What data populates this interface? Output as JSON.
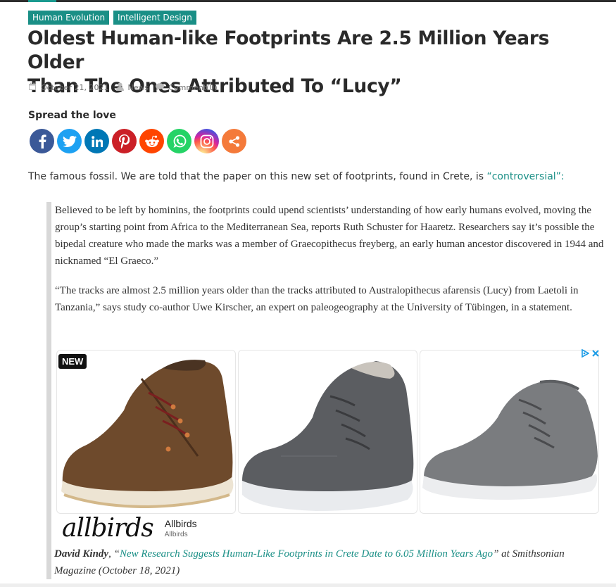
{
  "tags": [
    "Human Evolution",
    "Intelligent Design"
  ],
  "title_line1": "Oldest Human-like Footprints Are 2.5 Million Years Older",
  "title_line2": "Than The Ones Attributed To “Lucy”",
  "meta": {
    "date": "October 21, 2021",
    "category": "News",
    "comments": "Comment(0)"
  },
  "spread_label": "Spread the love",
  "socials": [
    {
      "name": "facebook",
      "color": "#3b5998"
    },
    {
      "name": "twitter",
      "color": "#1da1f2"
    },
    {
      "name": "linkedin",
      "color": "#0077b5"
    },
    {
      "name": "pinterest",
      "color": "#cb2027"
    },
    {
      "name": "reddit",
      "color": "#ff4500"
    },
    {
      "name": "whatsapp",
      "color": "#25d366"
    },
    {
      "name": "instagram",
      "color": "#c13584"
    },
    {
      "name": "more",
      "color": "#f47a3a"
    }
  ],
  "intro": {
    "text": "The famous fossil. We are told that the paper on this new set of footprints, found in Crete, is ",
    "link": "“controversial”:"
  },
  "quote": {
    "p1": "Believed to be left by hominins, the footprints could upend scientists’ understanding of how early humans evolved, moving the group’s starting point from Africa to the Mediterranean Sea, reports Ruth Schuster for Haaretz. Researchers say it’s possible the bipedal creature who made the marks was a member of Graecopithecus freyberg, an early human ancestor discovered in 1944 and nicknamed “El Graeco.”",
    "p2": "“The tracks are almost 2.5 million years older than the tracks attributed to Australopithecus afarensis (Lucy) from Laetoli in Tanzania,” says study co-author Uwe Kirscher, an expert on paleogeography at the University of Tübingen, in a statement."
  },
  "ad": {
    "badge": "NEW",
    "brand_logo": "allbirds",
    "brand_name": "Allbirds",
    "brand_sub": "Allbirds"
  },
  "citation": {
    "author": "David Kindy",
    "sep1": ", “",
    "link": "New Research Suggests Human-Like Footprints in Crete Date to 6.05 Million Years Ago",
    "rest": "” at Smithsonian Magazine (October 18, 2021)"
  }
}
